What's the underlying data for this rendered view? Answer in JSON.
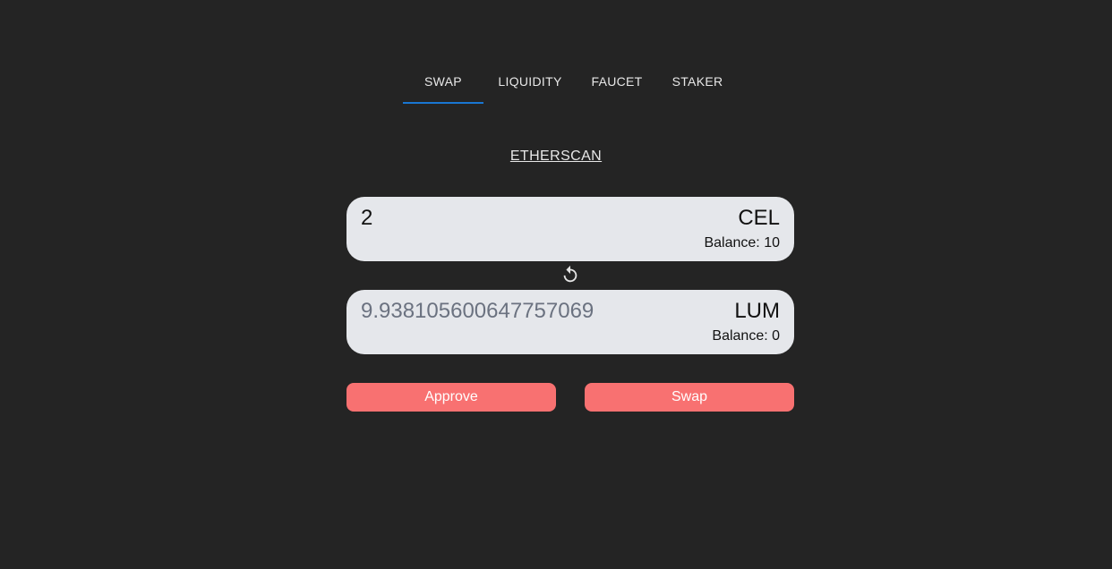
{
  "nav": {
    "tabs": [
      {
        "label": "SWAP",
        "active": true
      },
      {
        "label": "LIQUIDITY",
        "active": false
      },
      {
        "label": "FAUCET",
        "active": false
      },
      {
        "label": "STAKER",
        "active": false
      }
    ],
    "active_color": "#1976d2"
  },
  "explorer_link": "ETHERSCAN",
  "swap": {
    "from": {
      "amount": "2",
      "symbol": "CEL",
      "balance": "Balance: 10"
    },
    "switch_icon": "rotate-icon",
    "to": {
      "amount": "9.938105600647757069",
      "symbol": "LUM",
      "balance": "Balance: 0"
    }
  },
  "actions": {
    "approve_label": "Approve",
    "swap_label": "Swap",
    "button_color": "#f87171"
  },
  "colors": {
    "background": "#242424",
    "box": "#e5e7eb"
  }
}
